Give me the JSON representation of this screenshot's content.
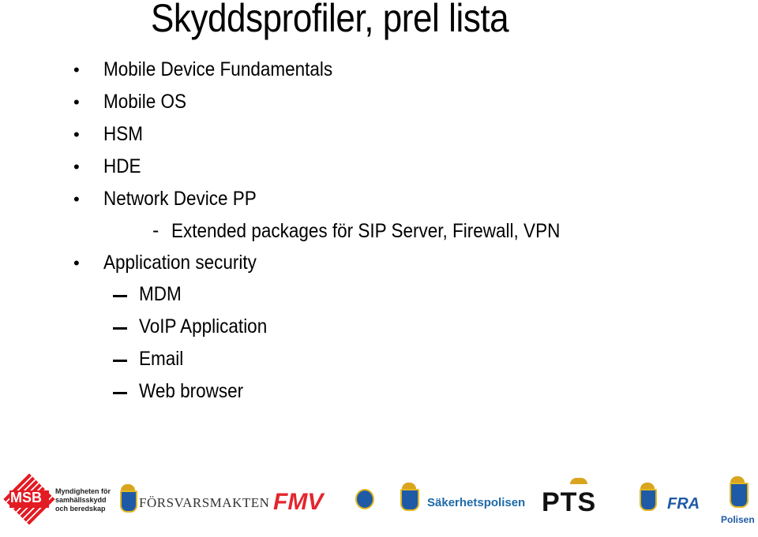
{
  "slide": {
    "title": "Skyddsprofiler, prel lista",
    "bullets": [
      {
        "text": "Mobile Device Fundamentals",
        "marker": "•"
      },
      {
        "text": "Mobile OS",
        "marker": "•"
      },
      {
        "text": "HSM",
        "marker": "•"
      },
      {
        "text": "HDE",
        "marker": "•"
      },
      {
        "text": "Network Device PP",
        "marker": "•"
      }
    ],
    "network_sub": {
      "marker": "-",
      "text": "Extended packages för SIP Server, Firewall, VPN"
    },
    "app_bullet": {
      "text": "Application security",
      "marker": "•"
    },
    "app_subitems": [
      "MDM",
      "VoIP Application",
      "Email",
      "Web browser"
    ]
  },
  "logos": {
    "msb": {
      "mark": "MSB",
      "line1": "Myndigheten för",
      "line2": "samhällsskydd",
      "line3": "och beredskap",
      "color": "#e31b23"
    },
    "forsvarsmakten": {
      "text": "FÖRSVARSMAKTEN"
    },
    "fmv": {
      "text": "FMV",
      "color": "#e3262e"
    },
    "sakerhetspolisen": {
      "text": "Säkerhetspolisen",
      "color": "#1f6aa8"
    },
    "pts": {
      "text": "PTS"
    },
    "fra": {
      "text": "FRA",
      "color": "#1f5aa6"
    },
    "polisen": {
      "text": "Polisen",
      "color": "#1f5aa6"
    }
  }
}
